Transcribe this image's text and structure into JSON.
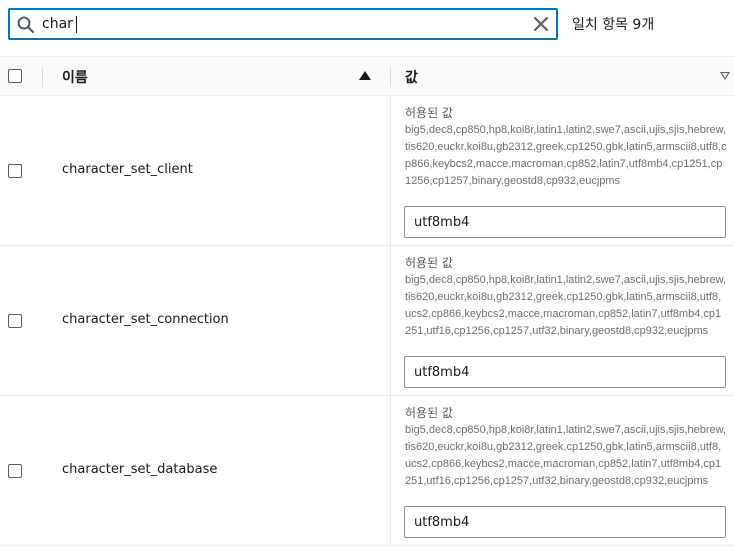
{
  "search": {
    "value": "char",
    "match_count": "일치 항목 9개"
  },
  "table": {
    "columns": {
      "name": "이름",
      "value": "값"
    },
    "rows": [
      {
        "name": "character_set_client",
        "allowed_label": "허용된 값",
        "allowed_values": "big5,dec8,cp850,hp8,koi8r,latin1,latin2,swe7,ascii,ujis,sjis,hebrew,tis620,euckr,koi8u,gb2312,greek,cp1250,gbk,latin5,armscii8,utf8,cp866,keybcs2,macce,macroman,cp852,latin7,utf8mb4,cp1251,cp1256,cp1257,binary,geostd8,cp932,eucjpms",
        "value": "utf8mb4"
      },
      {
        "name": "character_set_connection",
        "allowed_label": "허용된 값",
        "allowed_values": "big5,dec8,cp850,hp8,koi8r,latin1,latin2,swe7,ascii,ujis,sjis,hebrew,tis620,euckr,koi8u,gb2312,greek,cp1250,gbk,latin5,armscii8,utf8,ucs2,cp866,keybcs2,macce,macroman,cp852,latin7,utf8mb4,cp1251,utf16,cp1256,cp1257,utf32,binary,geostd8,cp932,eucjpms",
        "value": "utf8mb4"
      },
      {
        "name": "character_set_database",
        "allowed_label": "허용된 값",
        "allowed_values": "big5,dec8,cp850,hp8,koi8r,latin1,latin2,swe7,ascii,ujis,sjis,hebrew,tis620,euckr,koi8u,gb2312,greek,cp1250,gbk,latin5,armscii8,utf8,ucs2,cp866,keybcs2,macce,macroman,cp852,latin7,utf8mb4,cp1251,utf16,cp1256,cp1257,utf32,binary,geostd8,cp932,eucjpms",
        "value": "utf8mb4"
      }
    ]
  },
  "icons": {
    "search": "search-icon",
    "clear": "close-icon",
    "sort_asc": "sort-ascending-icon",
    "sort_desc": "sort-descending-icon"
  },
  "colors": {
    "accent": "#0073bb",
    "text": "#16191f",
    "muted": "#687078"
  }
}
